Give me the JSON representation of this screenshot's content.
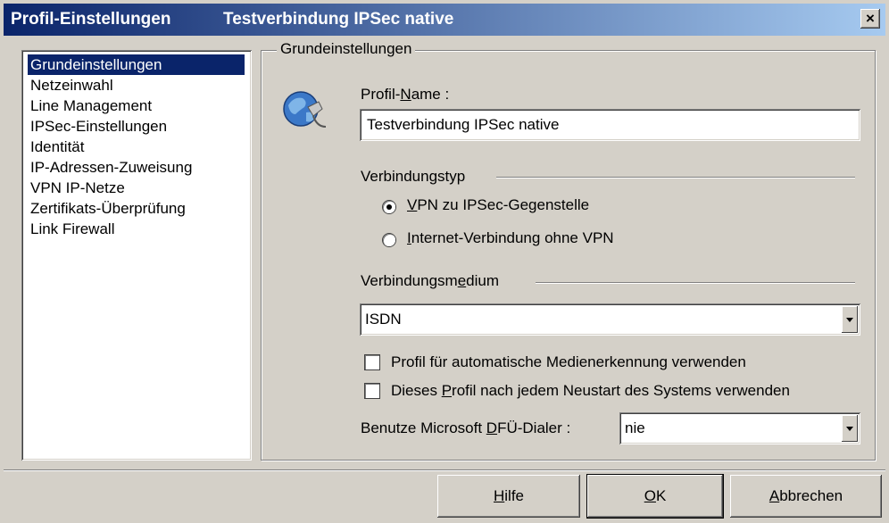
{
  "titlebar": {
    "title_left": "Profil-Einstellungen",
    "title_right": "Testverbindung IPSec native",
    "close_glyph": "×"
  },
  "nav": {
    "items": [
      {
        "label": "Grundeinstellungen",
        "selected": true
      },
      {
        "label": "Netzeinwahl"
      },
      {
        "label": "Line Management"
      },
      {
        "label": "IPSec-Einstellungen"
      },
      {
        "label": "Identität"
      },
      {
        "label": "IP-Adressen-Zuweisung"
      },
      {
        "label": "VPN IP-Netze"
      },
      {
        "label": "Zertifikats-Überprüfung"
      },
      {
        "label": "Link Firewall"
      }
    ]
  },
  "group": {
    "title": "Grundeinstellungen",
    "icon": "globe-plug-icon",
    "profile_name": {
      "label_pre": "Profil-",
      "label_u": "N",
      "label_post": "ame :",
      "value": "Testverbindung IPSec native"
    },
    "connection_type": {
      "title": "Verbindungstyp",
      "options": [
        {
          "u": "V",
          "rest": "PN zu IPSec-Gegenstelle",
          "checked": true
        },
        {
          "u": "I",
          "rest": "nternet-Verbindung ohne VPN",
          "checked": false
        }
      ]
    },
    "medium": {
      "title_pre": "Verbindungsm",
      "title_u": "e",
      "title_post": "dium",
      "value": "ISDN"
    },
    "checkboxes": {
      "auto_media": {
        "label": "Profil für automatische Medienerkennung verwenden",
        "checked": false
      },
      "restart": {
        "pre": "Dieses ",
        "u": "P",
        "post": "rofil nach jedem Neustart des Systems verwenden",
        "checked": false
      }
    },
    "dialer": {
      "label_pre": "Benutze Microsoft ",
      "label_u": "D",
      "label_post": "FÜ-Dialer :",
      "value": "nie"
    }
  },
  "buttons": {
    "help": {
      "u": "H",
      "rest": "ilfe"
    },
    "ok": {
      "u": "O",
      "rest": "K"
    },
    "cancel": {
      "u": "A",
      "rest": "bbrechen"
    }
  },
  "colors": {
    "face": "#d4d0c8",
    "selection": "#0a246a",
    "title_gradient_end": "#a6caf0"
  }
}
